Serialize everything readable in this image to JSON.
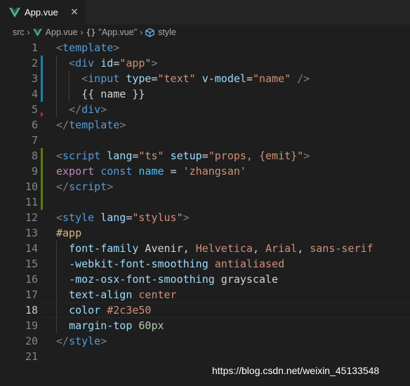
{
  "tab": {
    "label": "App.vue",
    "close": "×",
    "icon": "vue-icon"
  },
  "breadcrumb": {
    "items": [
      "src",
      "App.vue",
      "\"App.vue\"",
      "style"
    ],
    "braces": "{}"
  },
  "colors": {
    "editor_bg": "#1e1e1e",
    "tag": "#569cd6",
    "attribute": "#9cdcfe",
    "string": "#ce9178",
    "keyword": "#c586c0",
    "number": "#b5cea8",
    "selector": "#d7ba7d"
  },
  "editor": {
    "line_numbers": [
      "1",
      "2",
      "3",
      "4",
      "5",
      "6",
      "7",
      "8",
      "9",
      "10",
      "11",
      "12",
      "13",
      "14",
      "15",
      "16",
      "17",
      "18",
      "19",
      "20",
      "21"
    ],
    "lines": [
      [
        [
          "<",
          "punc"
        ],
        [
          "template",
          "tag"
        ],
        [
          ">",
          "punc"
        ]
      ],
      [
        [
          "  ",
          "plain"
        ],
        [
          "<",
          "punc"
        ],
        [
          "div",
          "tag"
        ],
        [
          " ",
          "plain"
        ],
        [
          "id",
          "attr"
        ],
        [
          "=",
          "plain"
        ],
        [
          "\"app\"",
          "str"
        ],
        [
          ">",
          "punc"
        ]
      ],
      [
        [
          "    ",
          "plain"
        ],
        [
          "<",
          "punc"
        ],
        [
          "input",
          "tag"
        ],
        [
          " ",
          "plain"
        ],
        [
          "type",
          "attr"
        ],
        [
          "=",
          "plain"
        ],
        [
          "\"text\"",
          "str"
        ],
        [
          " ",
          "plain"
        ],
        [
          "v-model",
          "attr"
        ],
        [
          "=",
          "plain"
        ],
        [
          "\"name\"",
          "str"
        ],
        [
          " ",
          "plain"
        ],
        [
          "/>",
          "punc"
        ]
      ],
      [
        [
          "    ",
          "plain"
        ],
        [
          "{{ name }}",
          "plain"
        ]
      ],
      [
        [
          "  ",
          "plain"
        ],
        [
          "</",
          "punc"
        ],
        [
          "div",
          "tag"
        ],
        [
          ">",
          "punc"
        ]
      ],
      [
        [
          "</",
          "punc"
        ],
        [
          "template",
          "tag"
        ],
        [
          ">",
          "punc"
        ]
      ],
      [],
      [
        [
          "<",
          "punc"
        ],
        [
          "script",
          "tag"
        ],
        [
          " ",
          "plain"
        ],
        [
          "lang",
          "attr"
        ],
        [
          "=",
          "plain"
        ],
        [
          "\"ts\"",
          "str"
        ],
        [
          " ",
          "plain"
        ],
        [
          "setup",
          "attr"
        ],
        [
          "=",
          "plain"
        ],
        [
          "\"props, {emit}\"",
          "str"
        ],
        [
          ">",
          "punc"
        ]
      ],
      [
        [
          "export",
          "kw"
        ],
        [
          " ",
          "plain"
        ],
        [
          "const",
          "kw2"
        ],
        [
          " ",
          "plain"
        ],
        [
          "name",
          "var"
        ],
        [
          " = ",
          "plain"
        ],
        [
          "'zhangsan'",
          "str"
        ]
      ],
      [
        [
          "</",
          "punc"
        ],
        [
          "script",
          "tag"
        ],
        [
          ">",
          "punc"
        ]
      ],
      [],
      [
        [
          "<",
          "punc"
        ],
        [
          "style",
          "tag"
        ],
        [
          " ",
          "plain"
        ],
        [
          "lang",
          "attr"
        ],
        [
          "=",
          "plain"
        ],
        [
          "\"stylus\"",
          "str"
        ],
        [
          ">",
          "punc"
        ]
      ],
      [
        [
          "#app",
          "sel"
        ]
      ],
      [
        [
          "  ",
          "plain"
        ],
        [
          "font-family",
          "prop"
        ],
        [
          " Avenir, ",
          "plain"
        ],
        [
          "Helvetica",
          "val"
        ],
        [
          ", ",
          "plain"
        ],
        [
          "Arial",
          "val"
        ],
        [
          ", ",
          "plain"
        ],
        [
          "sans-serif",
          "val"
        ]
      ],
      [
        [
          "  ",
          "plain"
        ],
        [
          "-webkit-font-smoothing",
          "prop"
        ],
        [
          " ",
          "plain"
        ],
        [
          "antialiased",
          "val"
        ]
      ],
      [
        [
          "  ",
          "plain"
        ],
        [
          "-moz-osx-font-smoothing",
          "prop"
        ],
        [
          " grayscale",
          "plain"
        ]
      ],
      [
        [
          "  ",
          "plain"
        ],
        [
          "text-align",
          "prop"
        ],
        [
          " ",
          "plain"
        ],
        [
          "center",
          "val"
        ]
      ],
      [
        [
          "  ",
          "plain"
        ],
        [
          "color",
          "prop"
        ],
        [
          " ",
          "plain"
        ],
        [
          "#2c3e50",
          "val"
        ]
      ],
      [
        [
          "  ",
          "plain"
        ],
        [
          "margin-top",
          "prop"
        ],
        [
          " ",
          "plain"
        ],
        [
          "60px",
          "num"
        ]
      ],
      [
        [
          "</",
          "punc"
        ],
        [
          "style",
          "tag"
        ],
        [
          ">",
          "punc"
        ]
      ],
      []
    ]
  },
  "watermark": "https://blog.csdn.net/weixin_45133548"
}
